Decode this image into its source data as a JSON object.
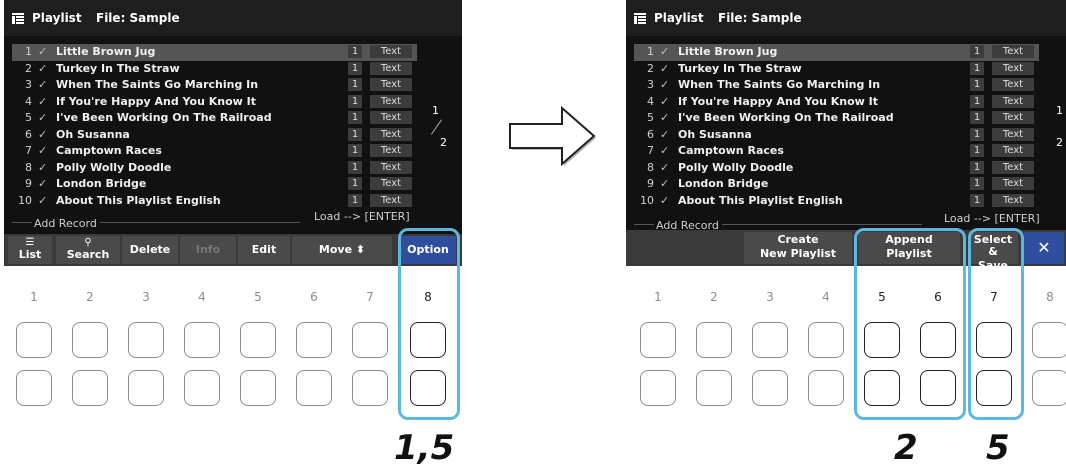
{
  "header": {
    "title": "Playlist",
    "file": "File: Sample"
  },
  "rows": [
    {
      "num": "1",
      "name": "Little Brown Jug",
      "count": "1",
      "tag": "Text",
      "selected": true
    },
    {
      "num": "2",
      "name": "Turkey In The Straw",
      "count": "1",
      "tag": "Text"
    },
    {
      "num": "3",
      "name": "When The Saints Go Marching In",
      "count": "1",
      "tag": "Text"
    },
    {
      "num": "4",
      "name": "If You're Happy And You Know It",
      "count": "1",
      "tag": "Text"
    },
    {
      "num": "5",
      "name": "I've Been Working On The Railroad",
      "count": "1",
      "tag": "Text"
    },
    {
      "num": "6",
      "name": "Oh Susanna",
      "count": "1",
      "tag": "Text"
    },
    {
      "num": "7",
      "name": "Camptown Races",
      "count": "1",
      "tag": "Text"
    },
    {
      "num": "8",
      "name": "Polly Wolly Doodle",
      "count": "1",
      "tag": "Text"
    },
    {
      "num": "9",
      "name": "London Bridge",
      "count": "1",
      "tag": "Text"
    },
    {
      "num": "10",
      "name": "About This Playlist English",
      "count": "1",
      "tag": "Text"
    }
  ],
  "check_mark": "✓",
  "pages": {
    "current": "1",
    "total": "2"
  },
  "add_record": "Add Record",
  "load_hint": "Load --> [ENTER]",
  "left_buttons": {
    "list": "List",
    "search": "Search",
    "delete": "Delete",
    "info": "Info",
    "edit": "Edit",
    "move": "Move",
    "move_glyph": "⬍",
    "option": "Option"
  },
  "right_buttons": {
    "create_1": "Create",
    "create_2": "New Playlist",
    "append_1": "Append",
    "append_2": "Playlist",
    "select_1": "Select &",
    "select_2": "Save",
    "close": "✕"
  },
  "left_keys": [
    "1",
    "2",
    "3",
    "4",
    "5",
    "6",
    "7",
    "8"
  ],
  "right_keys": [
    "1",
    "2",
    "3",
    "4",
    "5",
    "6",
    "7",
    "8"
  ],
  "step_labels": {
    "left": "1,5",
    "right_a": "2",
    "right_b": "5"
  },
  "colors": {
    "highlight_frame": "#5db7e0",
    "option_button": "#2f4f9e"
  }
}
